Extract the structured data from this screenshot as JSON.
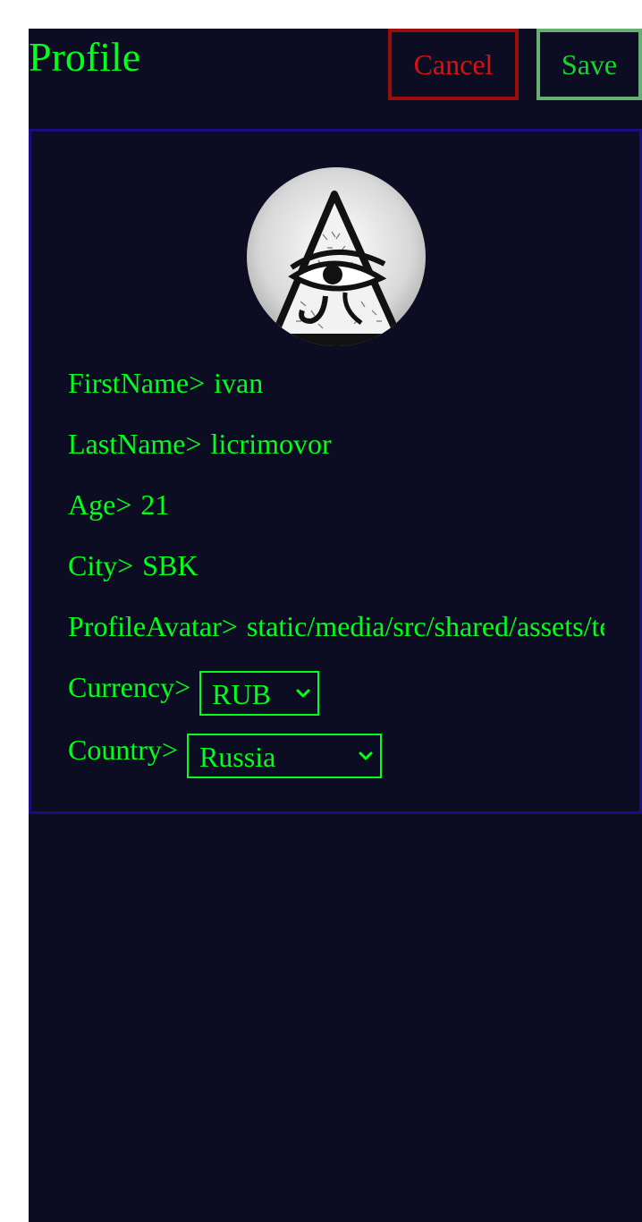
{
  "header": {
    "title": "Profile",
    "cancel_label": "Cancel",
    "save_label": "Save"
  },
  "profile": {
    "first_name": {
      "label": "FirstName>",
      "value": "ivan"
    },
    "last_name": {
      "label": "LastName>",
      "value": "licrimovor"
    },
    "age": {
      "label": "Age>",
      "value": "21"
    },
    "city": {
      "label": "City>",
      "value": "SBK"
    },
    "avatar": {
      "label": "ProfileAvatar>",
      "value": "static/media/src/shared/assets/te"
    },
    "currency": {
      "label": "Currency>",
      "value": "RUB"
    },
    "country": {
      "label": "Country>",
      "value": "Russia"
    }
  },
  "icons": {
    "avatar": "eye-of-providence-image",
    "select_arrow": "chevron-down-icon"
  },
  "colors": {
    "background": "#0c0d22",
    "text": "#00ff1a",
    "cancel": "#e00f0f",
    "save": "#66b073",
    "card_border": "#1e0b7e"
  }
}
